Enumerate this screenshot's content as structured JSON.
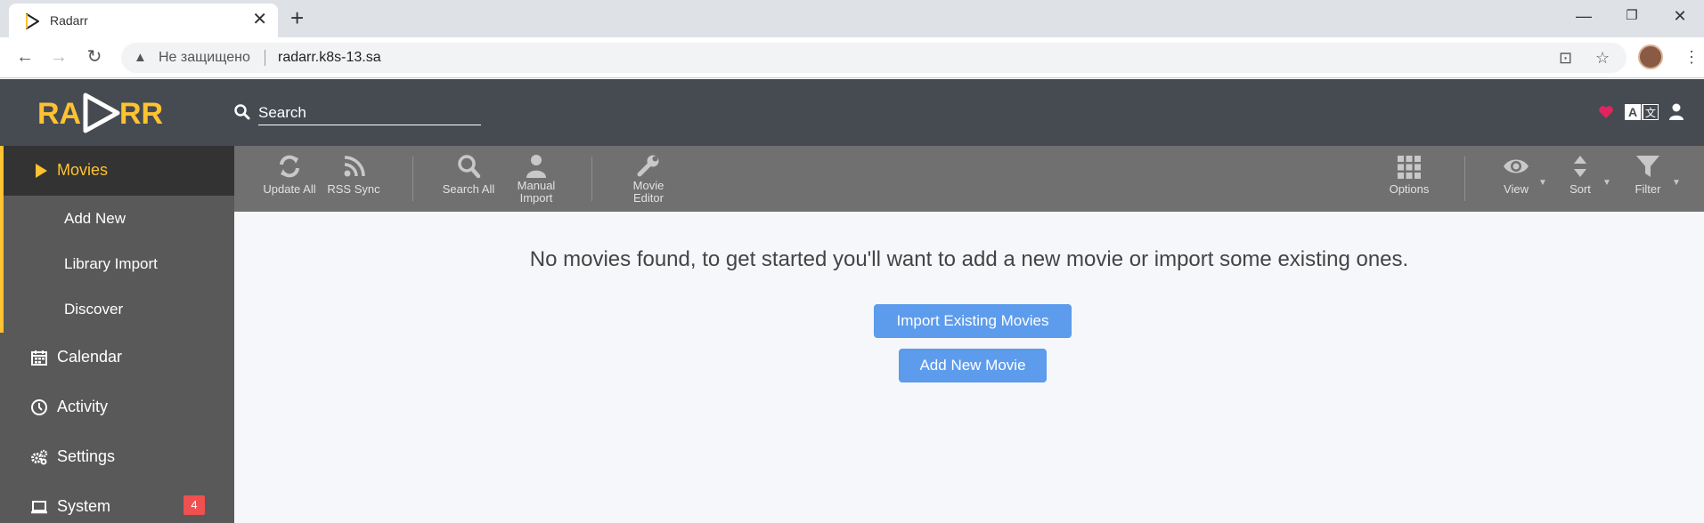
{
  "browser": {
    "tab_title": "Radarr",
    "security_label": "Не защищено",
    "url": "radarr.k8s-13.sa"
  },
  "header": {
    "logo_text": "RADARR",
    "search_placeholder": "Search"
  },
  "sidebar": {
    "items": [
      {
        "label": "Movies",
        "icon": "play-icon",
        "active": true
      },
      {
        "label": "Calendar",
        "icon": "calendar-icon"
      },
      {
        "label": "Activity",
        "icon": "clock-icon"
      },
      {
        "label": "Settings",
        "icon": "gears-icon"
      },
      {
        "label": "System",
        "icon": "laptop-icon",
        "badge": "4"
      }
    ],
    "movies_sub": [
      "Add New",
      "Library Import",
      "Discover"
    ]
  },
  "toolbar": {
    "update_all": "Update All",
    "rss_sync": "RSS Sync",
    "search_all": "Search All",
    "manual_import_1": "Manual",
    "manual_import_2": "Import",
    "movie_editor_1": "Movie",
    "movie_editor_2": "Editor",
    "options": "Options",
    "view": "View",
    "sort": "Sort",
    "filter": "Filter"
  },
  "content": {
    "empty_message": "No movies found, to get started you'll want to add a new movie or import some existing ones.",
    "import_button": "Import Existing Movies",
    "add_button": "Add New Movie"
  },
  "colors": {
    "accent": "#ffc230",
    "header_bg": "#464b51",
    "sidebar_bg": "#595959",
    "toolbar_bg": "#707070",
    "primary_button": "#5d9cec",
    "badge": "#f05050"
  }
}
